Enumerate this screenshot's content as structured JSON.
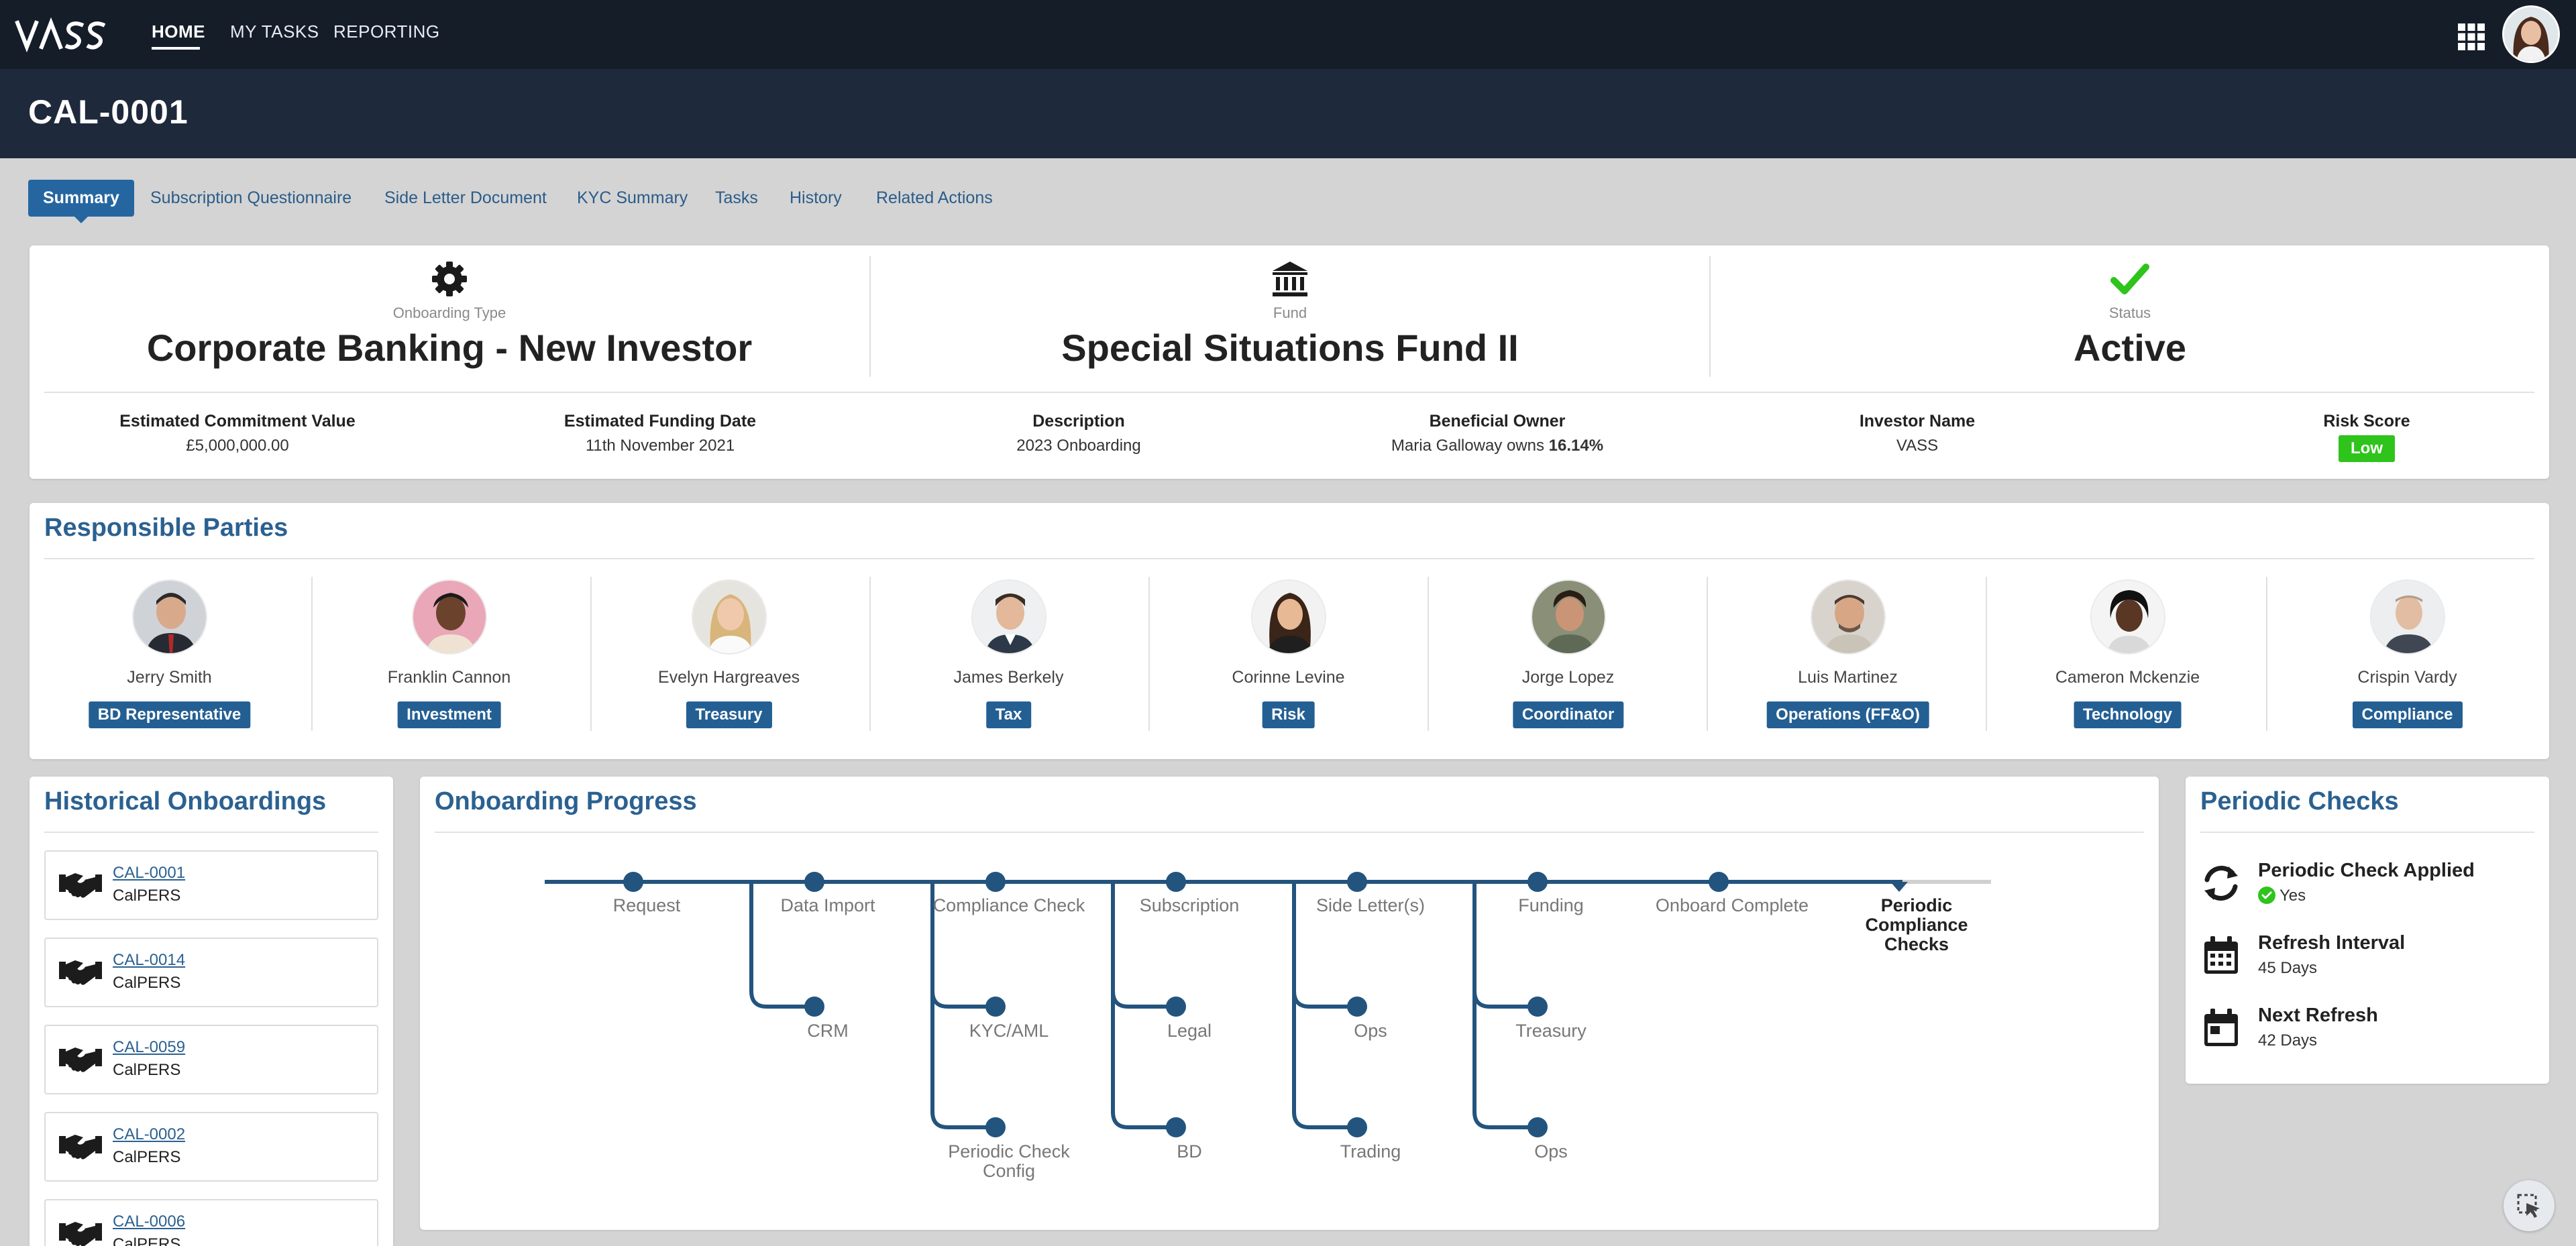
{
  "nav": {
    "items": [
      {
        "label": "HOME",
        "active": true
      },
      {
        "label": "MY TASKS",
        "active": false
      },
      {
        "label": "REPORTING",
        "active": false
      }
    ]
  },
  "header": {
    "title": "CAL-0001"
  },
  "tabs": [
    {
      "label": "Summary",
      "active": true
    },
    {
      "label": "Subscription Questionnaire"
    },
    {
      "label": "Side Letter Document"
    },
    {
      "label": "KYC Summary"
    },
    {
      "label": "Tasks"
    },
    {
      "label": "History"
    },
    {
      "label": "Related Actions"
    }
  ],
  "summary": {
    "onboarding_type": {
      "label": "Onboarding Type",
      "value": "Corporate Banking - New Investor",
      "icon": "gear-icon"
    },
    "fund": {
      "label": "Fund",
      "value": "Special Situations Fund II",
      "icon": "bank-icon"
    },
    "status": {
      "label": "Status",
      "value": "Active",
      "icon": "checkmark-icon",
      "color": "#2ec41b"
    },
    "details": [
      {
        "label": "Estimated Commitment Value",
        "value": "£5,000,000.00"
      },
      {
        "label": "Estimated Funding Date",
        "value": "11th November 2021"
      },
      {
        "label": "Description",
        "value": "2023 Onboarding"
      },
      {
        "label": "Beneficial Owner",
        "value_prefix": "Maria Galloway owns",
        "value_bold": "16.14%"
      },
      {
        "label": "Investor Name",
        "value": "VASS"
      },
      {
        "label": "Risk Score",
        "badge": "Low",
        "badge_color": "#2ec41b"
      }
    ]
  },
  "responsible_parties": {
    "title": "Responsible Parties",
    "people": [
      {
        "name": "Jerry Smith",
        "role": "BD Representative"
      },
      {
        "name": "Franklin Cannon",
        "role": "Investment"
      },
      {
        "name": "Evelyn Hargreaves",
        "role": "Treasury"
      },
      {
        "name": "James Berkely",
        "role": "Tax"
      },
      {
        "name": "Corinne Levine",
        "role": "Risk"
      },
      {
        "name": "Jorge Lopez",
        "role": "Coordinator"
      },
      {
        "name": "Luis Martinez",
        "role": "Operations (FF&O)"
      },
      {
        "name": "Cameron Mckenzie",
        "role": "Technology"
      },
      {
        "name": "Crispin Vardy",
        "role": "Compliance"
      }
    ]
  },
  "historical": {
    "title": "Historical Onboardings",
    "items": [
      {
        "code": "CAL-0001",
        "name": "CalPERS"
      },
      {
        "code": "CAL-0014",
        "name": "CalPERS"
      },
      {
        "code": "CAL-0059",
        "name": "CalPERS"
      },
      {
        "code": "CAL-0002",
        "name": "CalPERS"
      },
      {
        "code": "CAL-0006",
        "name": "CalPERS"
      }
    ]
  },
  "progress": {
    "title": "Onboarding Progress",
    "main_steps": [
      "Request",
      "Data Import",
      "Compliance Check",
      "Subscription",
      "Side Letter(s)",
      "Funding",
      "Onboard Complete"
    ],
    "final_step": [
      "Periodic",
      "Compliance",
      "Checks"
    ],
    "branches": [
      {
        "parent": "Data Import",
        "children": [
          "CRM"
        ]
      },
      {
        "parent": "Compliance Check",
        "children": [
          "KYC/AML",
          "Periodic Check Config"
        ]
      },
      {
        "parent": "Subscription",
        "children": [
          "Legal",
          "BD"
        ]
      },
      {
        "parent": "Side Letter(s)",
        "children": [
          "Ops",
          "Trading"
        ]
      },
      {
        "parent": "Funding",
        "children": [
          "Treasury",
          "Ops"
        ]
      }
    ],
    "periodic_check_config_lines": [
      "Periodic Check",
      "Config"
    ],
    "line_color": "#23547e"
  },
  "periodic_checks": {
    "title": "Periodic Checks",
    "rows": [
      {
        "label": "Periodic Check Applied",
        "value": "Yes",
        "icon": "refresh-icon"
      },
      {
        "label": "Refresh Interval",
        "value": "45 Days",
        "icon": "calendar-icon"
      },
      {
        "label": "Next Refresh",
        "value": "42 Days",
        "icon": "calendar-icon"
      }
    ]
  }
}
